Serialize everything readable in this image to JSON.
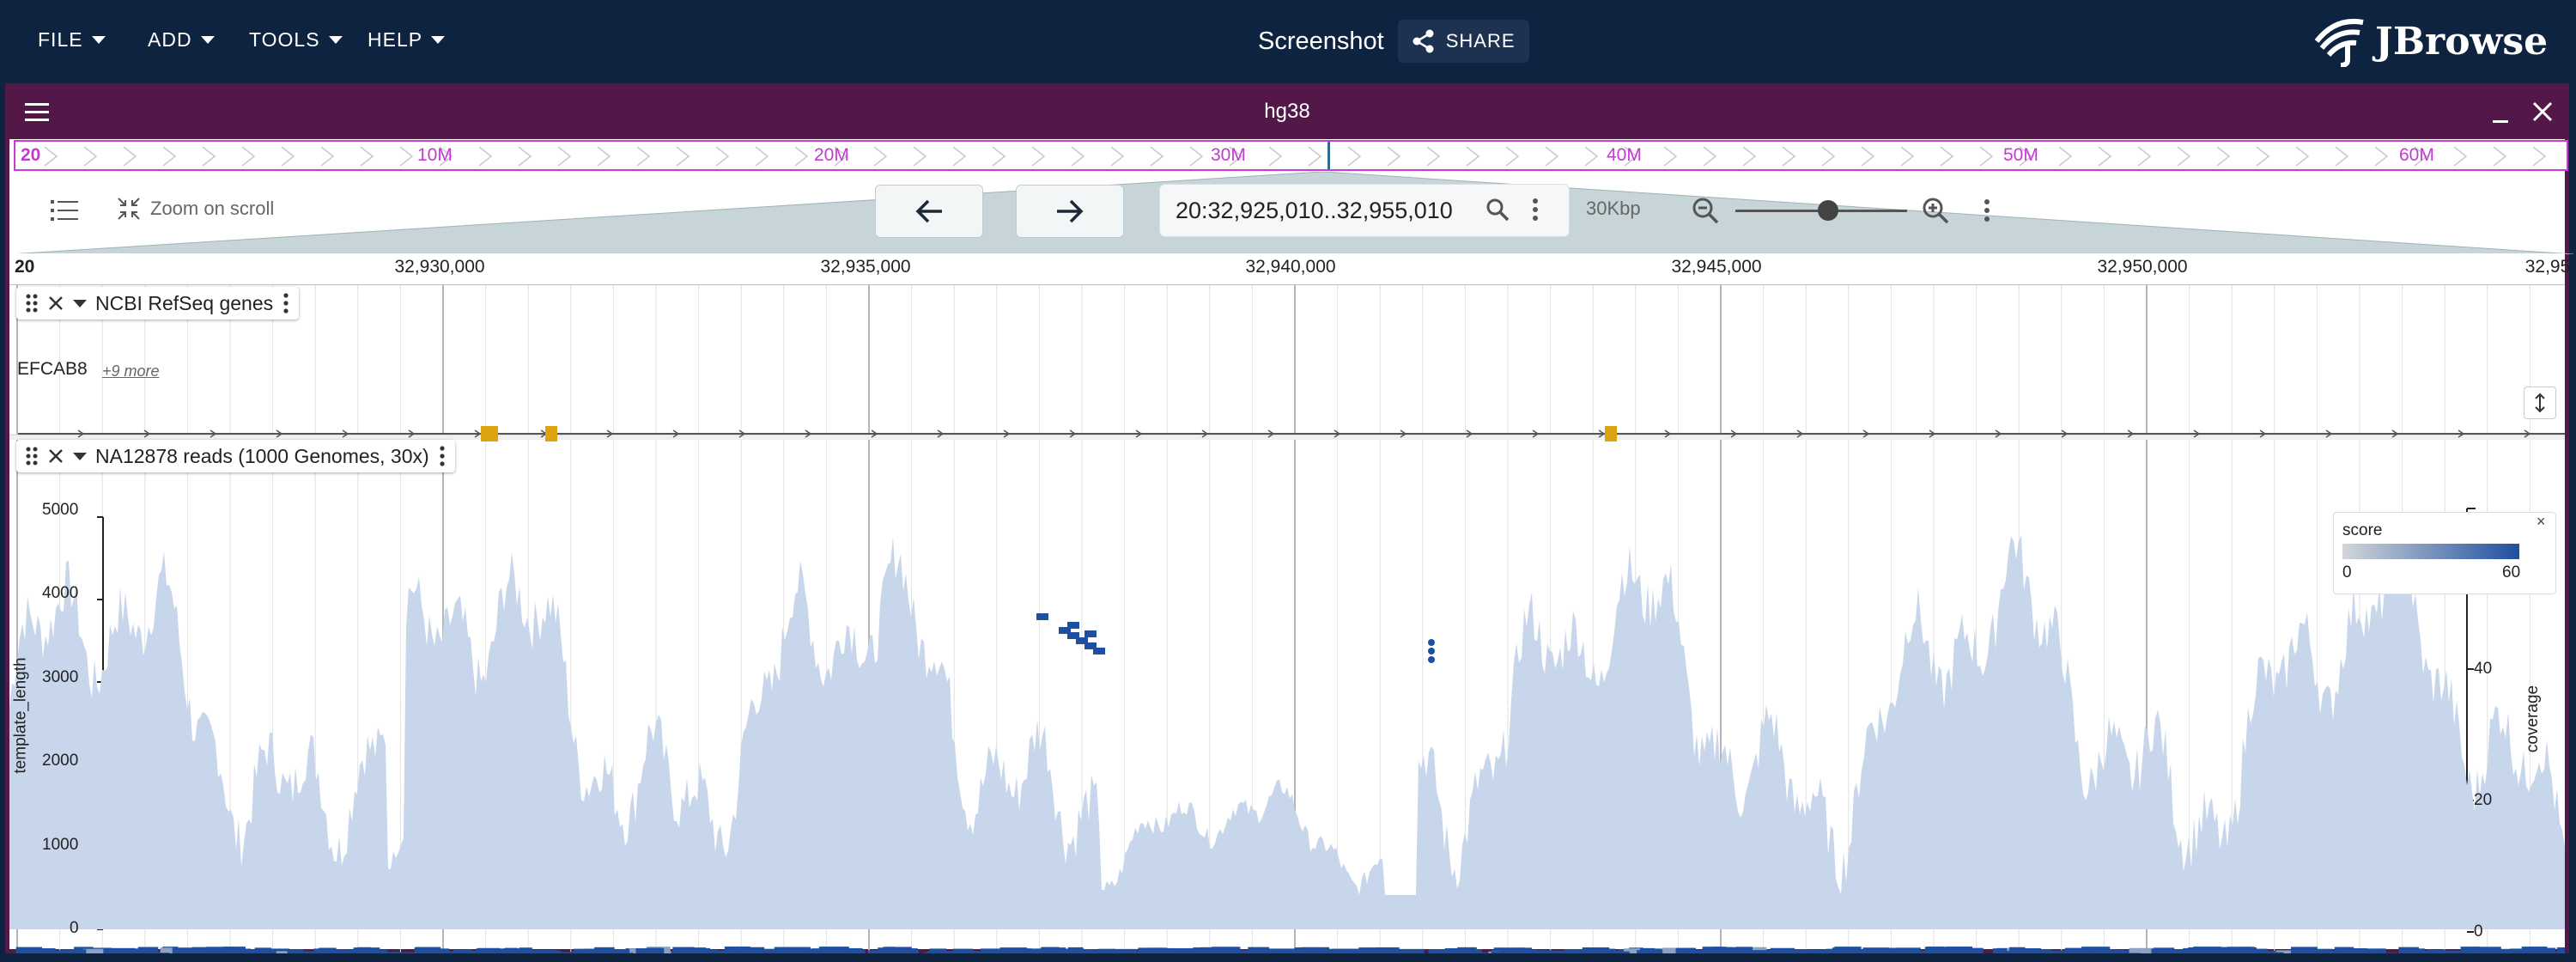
{
  "app": {
    "menus": [
      {
        "label": "FILE"
      },
      {
        "label": "ADD"
      },
      {
        "label": "TOOLS"
      },
      {
        "label": "HELP"
      }
    ],
    "session_title": "Screenshot",
    "share_label": "SHARE",
    "logo_text": "JBrowse"
  },
  "view": {
    "assembly": "hg38",
    "overview_labels": [
      "20",
      "10M",
      "20M",
      "30M",
      "40M",
      "50M",
      "60M"
    ],
    "zoom_on_scroll_label": "Zoom on scroll",
    "location": "20:32,925,010..32,955,010",
    "span_label": "30Kbp",
    "ruler_labels": [
      "20",
      "32,930,000",
      "32,935,000",
      "32,940,000",
      "32,945,000",
      "32,950,000",
      "32,95"
    ]
  },
  "tracks": [
    {
      "name": "NCBI RefSeq genes",
      "gene_label": "EFCAB8",
      "more_label": "+9 more"
    },
    {
      "name": "NA12878 reads (1000 Genomes, 30x)",
      "y_axis_title": "template_length",
      "y_ticks": [
        "5000",
        "4000",
        "3000",
        "2000",
        "1000",
        "0"
      ],
      "right_axis_title": "coverage",
      "right_ticks": [
        "40",
        "20",
        "0"
      ],
      "legend": {
        "title": "score",
        "min": "0",
        "max": "60",
        "close": "×"
      }
    }
  ],
  "colors": {
    "appbar": "#0d2340",
    "view_border": "#531847",
    "overview_accent": "#c23ad0",
    "coverage_fill": "#c7d6eb",
    "read_fill": "#1f4fa0",
    "gene_box": "#dba410"
  },
  "icons": [
    "share-icon",
    "hamburger-icon",
    "minimize-icon",
    "close-icon",
    "track-list-icon",
    "compress-icon",
    "arrow-left-icon",
    "arrow-right-icon",
    "search-icon",
    "kebab-icon",
    "zoom-out-icon",
    "zoom-in-icon",
    "drag-handle-icon",
    "expand-vertical-icon"
  ]
}
